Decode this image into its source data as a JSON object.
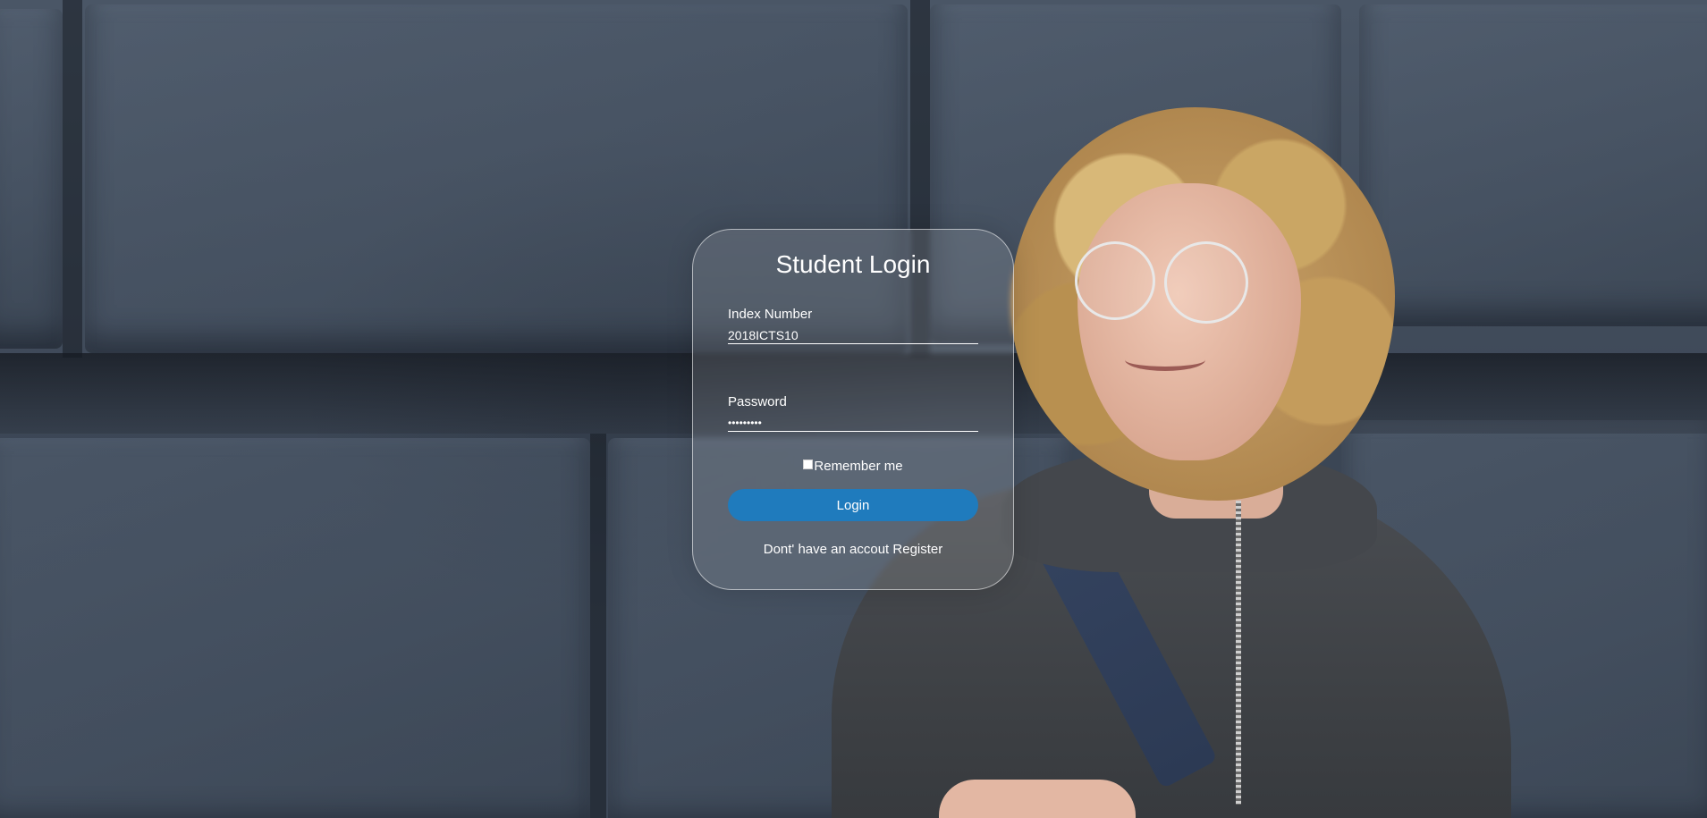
{
  "login_form": {
    "title": "Student Login",
    "index_label": "Index Number",
    "index_value": "2018ICTS10",
    "password_label": "Password",
    "password_value": "•••••••••",
    "remember_label": "Remember me",
    "remember_checked": false,
    "login_button": "Login",
    "register_prompt": "Dont' have an accout",
    "register_link": "Register"
  },
  "colors": {
    "button": "#1f7bbd",
    "text": "#ffffff",
    "wall": "#3f4a59"
  }
}
